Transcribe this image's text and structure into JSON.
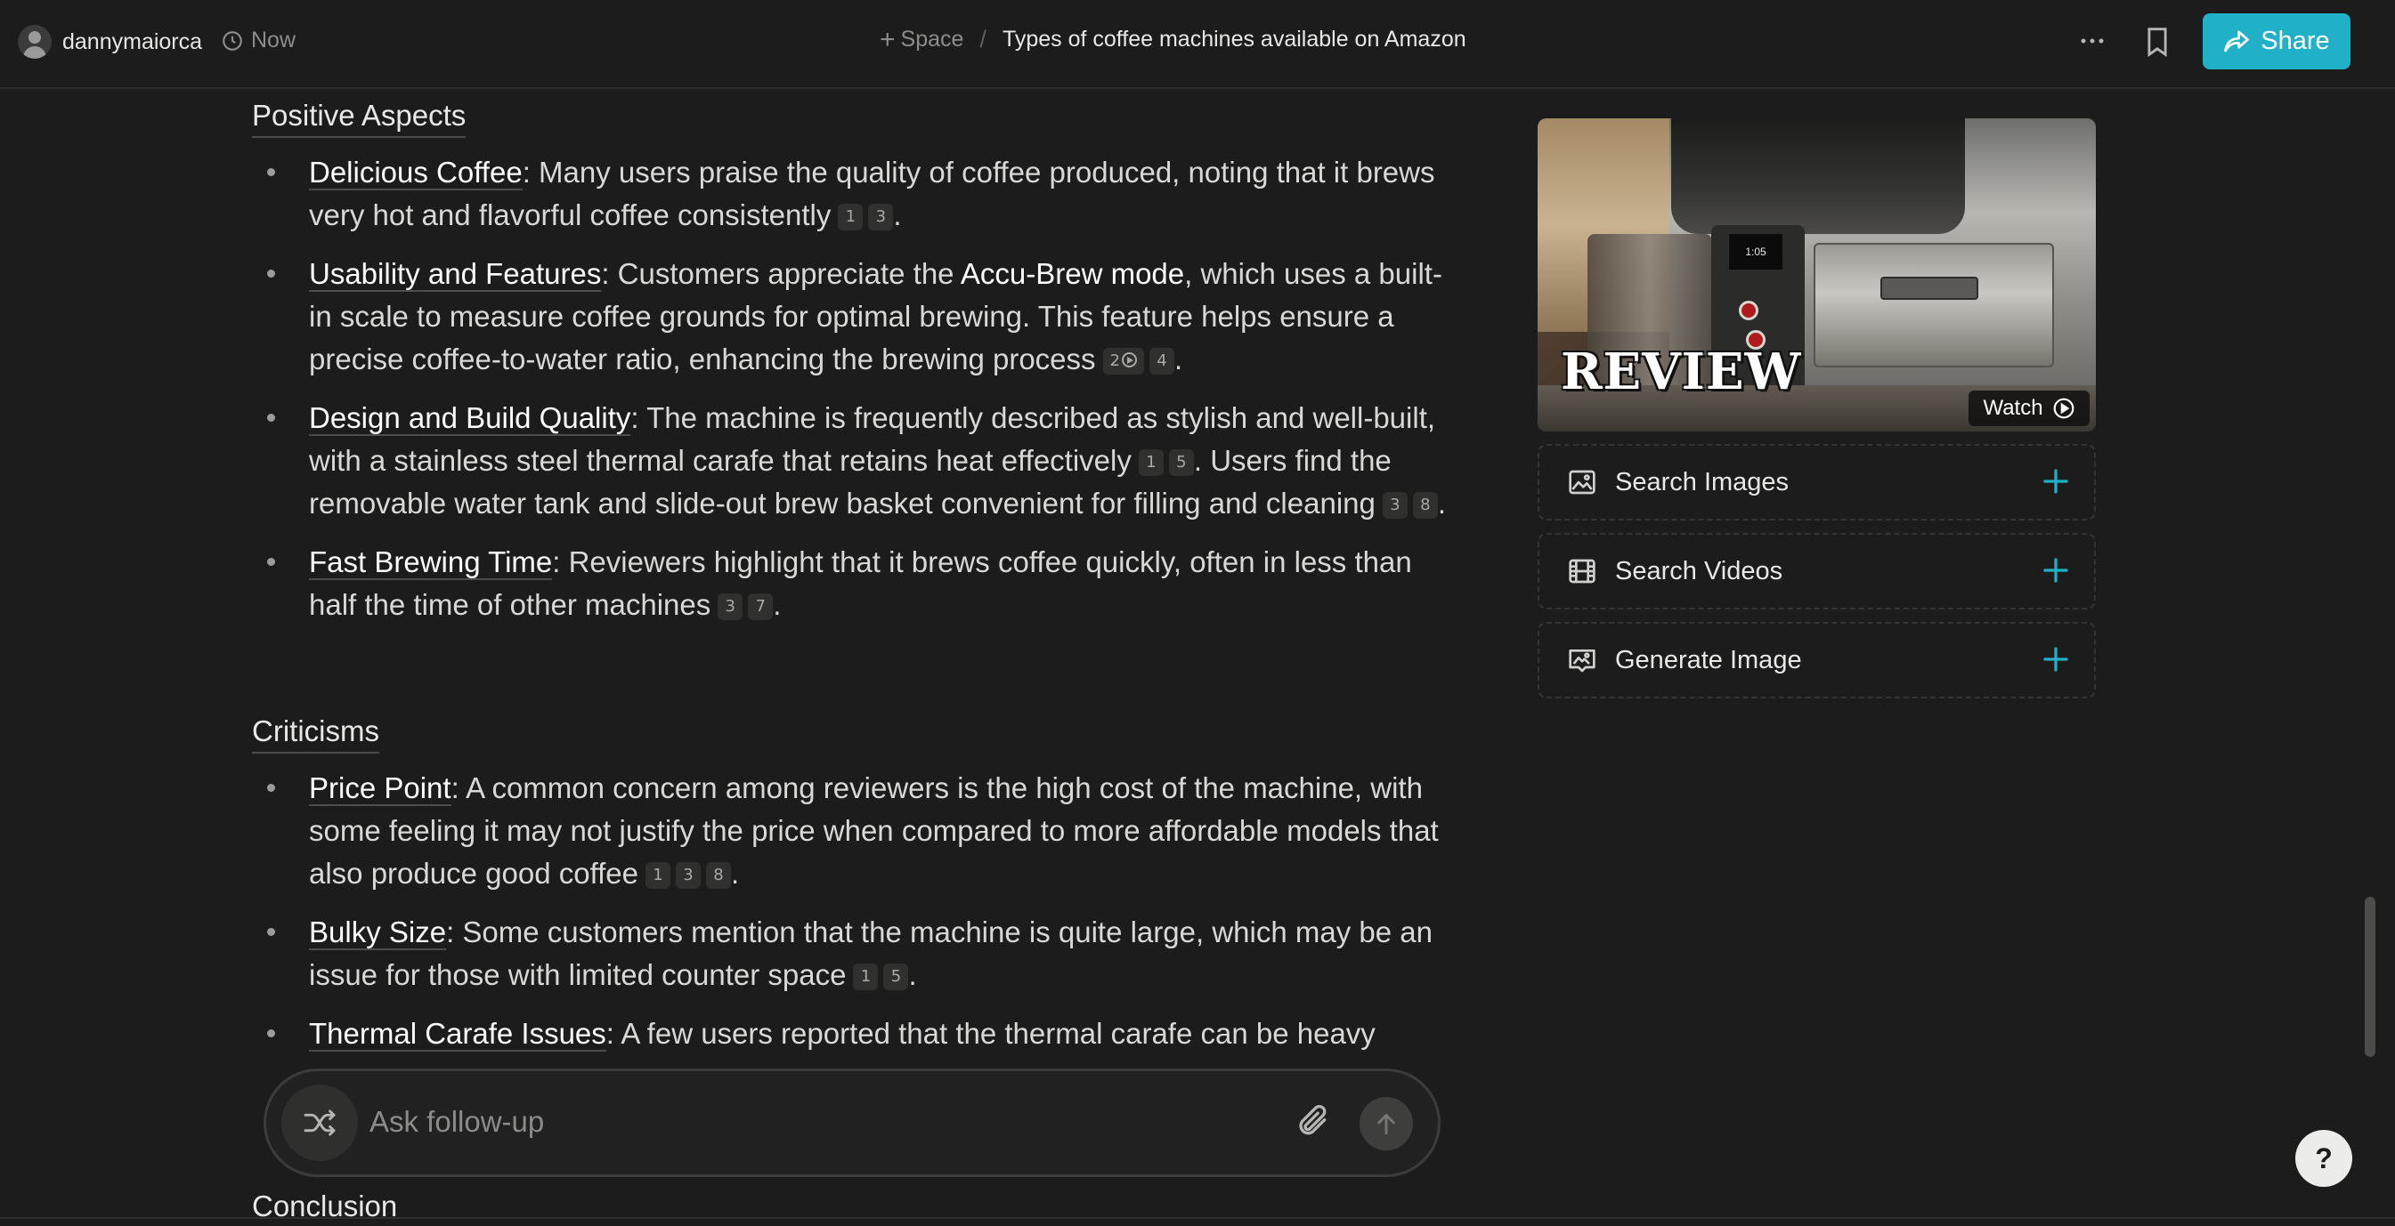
{
  "header": {
    "username": "dannymaiorca",
    "time": "Now",
    "space_label": "Space",
    "separator": "/",
    "thread_title": "Types of coffee machines available on Amazon",
    "share_label": "Share"
  },
  "article": {
    "positive_heading": "Positive Aspects",
    "positive_items": [
      {
        "term": "Delicious Coffee",
        "text": ": Many users praise the quality of coffee produced, noting that it brews very hot and flavorful coffee consistently",
        "cites": [
          "1",
          "3"
        ]
      },
      {
        "term": "Usability and Features",
        "text_before": ": Customers appreciate the ",
        "bold": "Accu-Brew mode",
        "text": ", which uses a built-in scale to measure coffee grounds for optimal brewing. This feature helps ensure a precise coffee-to-water ratio, enhancing the brewing process",
        "cites": [
          "2",
          "4"
        ]
      },
      {
        "term": "Design and Build Quality",
        "text": ": The machine is frequently described as stylish and well-built, with a stainless steel thermal carafe that retains heat effectively",
        "cites": [
          "1",
          "5"
        ],
        "text2": ". Users find the removable water tank and slide-out brew basket convenient for filling and cleaning",
        "cites2": [
          "3",
          "8"
        ]
      },
      {
        "term": "Fast Brewing Time",
        "text": ": Reviewers highlight that it brews coffee quickly, often in less than half the time of other machines",
        "cites": [
          "3",
          "7"
        ]
      }
    ],
    "criticisms_heading": "Criticisms",
    "criticism_items": [
      {
        "term": "Price Point",
        "text": ": A common concern among reviewers is the high cost of the machine, with some feeling it may not justify the price when compared to more affordable models that also produce good coffee",
        "cites": [
          "1",
          "3",
          "8"
        ]
      },
      {
        "term": "Bulky Size",
        "text": ": Some customers mention that the machine is quite large, which may be an issue for those with limited counter space",
        "cites": [
          "1",
          "5"
        ]
      },
      {
        "term": "Thermal Carafe Issues",
        "text": ": A few users reported that the thermal carafe can be heavy"
      }
    ],
    "conclusion_heading": "Conclusion"
  },
  "followup": {
    "placeholder": "Ask follow-up"
  },
  "sidebar": {
    "video": {
      "overlay_text": "REVIEW",
      "display_text": "1:05",
      "watch_label": "Watch"
    },
    "tools": [
      {
        "label": "Search Images",
        "icon": "image-icon"
      },
      {
        "label": "Search Videos",
        "icon": "film-icon"
      },
      {
        "label": "Generate Image",
        "icon": "generate-image-icon"
      }
    ]
  },
  "help_label": "?",
  "colors": {
    "background": "#1b1c1b",
    "accent": "#20b1c8",
    "text": "#e8e8e6",
    "muted": "#8c8d8a"
  }
}
